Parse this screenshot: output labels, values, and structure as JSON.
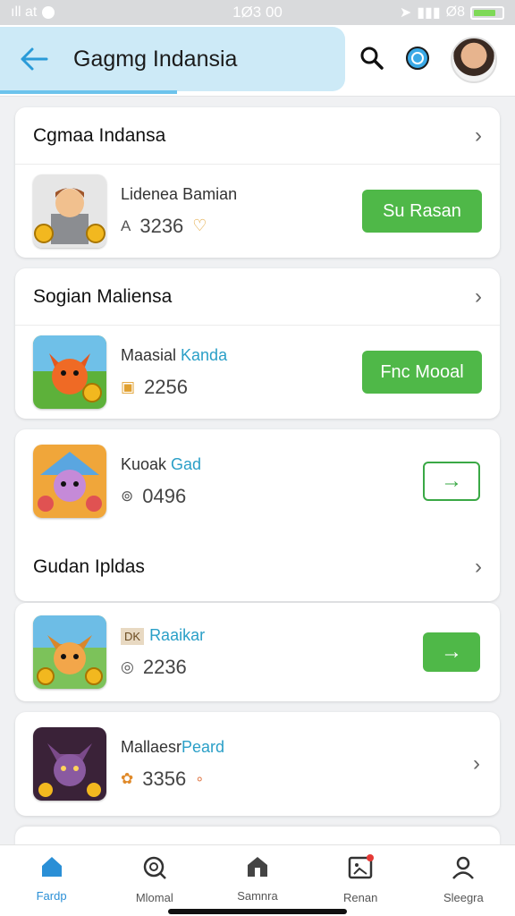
{
  "status_bar": {
    "carrier": "ıll at",
    "time": "1Ø3 00",
    "right_text": "Ø8"
  },
  "header": {
    "title": "Gagmg Indansia"
  },
  "section1": {
    "title": "Cgmaa Indansa",
    "game": {
      "name": "Lidenea Bamian",
      "stat_icon": "A",
      "count": "3236",
      "heart": "♡",
      "button": "Su Rasan"
    }
  },
  "section2": {
    "title": "Sogian Maliensa",
    "game": {
      "name_a": "Maasial ",
      "name_b": "Kanda",
      "stat_icon": "▣",
      "count": "2256",
      "button": "Fnc Mooal"
    }
  },
  "section3": {
    "game": {
      "name_a": "Kuoak ",
      "name_b": "Gad",
      "stat_icon": "⊚",
      "count": "0496"
    }
  },
  "section4": {
    "title": "Gudan Ipldas",
    "game": {
      "badge": "DK",
      "name": "Raaikar",
      "stat_icon": "◎",
      "count": "2236"
    }
  },
  "section5": {
    "game": {
      "name_a": "Mallaesr",
      "name_b": "Peard",
      "stat_icon": "✿",
      "count": "3356",
      "suffix": "∘"
    }
  },
  "nav": [
    {
      "label": "Fardp",
      "icon": "home-icon"
    },
    {
      "label": "Mlomal",
      "icon": "search-icon"
    },
    {
      "label": "Samnra",
      "icon": "shop-icon"
    },
    {
      "label": "Renan",
      "icon": "inbox-icon"
    },
    {
      "label": "Sleegra",
      "icon": "profile-icon"
    }
  ],
  "colors": {
    "accent": "#2a8fd6",
    "header_bg": "#cdeaf7",
    "green": "#4fb848"
  }
}
